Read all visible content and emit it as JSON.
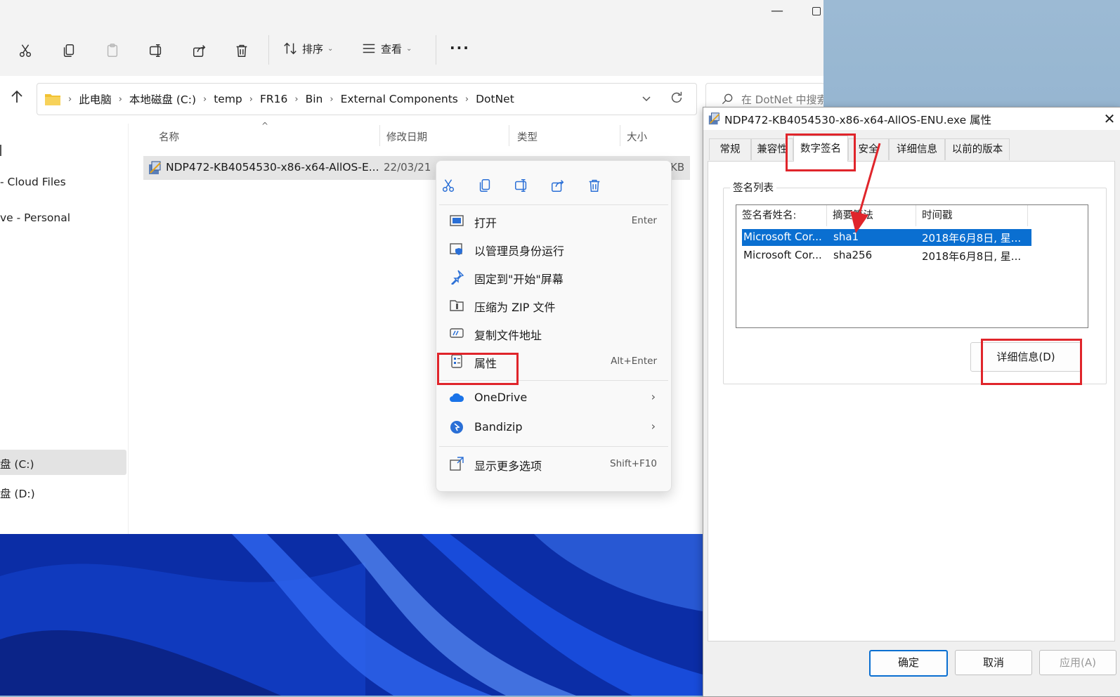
{
  "explorer": {
    "toolbar": {
      "sort_label": "排序",
      "view_label": "查看",
      "more_label": "···"
    },
    "breadcrumbs": [
      "此电脑",
      "本地磁盘 (C:)",
      "temp",
      "FR16",
      "Bin",
      "External Components",
      "DotNet"
    ],
    "search_placeholder": "在 DotNet 中搜索",
    "nav_items": [
      "- Cloud Files",
      "ve - Personal",
      "盘 (C:)",
      "盘 (D:)"
    ],
    "columns": [
      "名称",
      "修改日期",
      "类型",
      "大小"
    ],
    "file": {
      "name": "NDP472-KB4054530-x86-x64-AllOS-E...",
      "date": "22/03/21",
      "size": "KB"
    }
  },
  "context_menu": {
    "items": [
      {
        "label": "打开",
        "shortcut": "Enter"
      },
      {
        "label": "以管理员身份运行",
        "shortcut": ""
      },
      {
        "label": "固定到\"开始\"屏幕",
        "shortcut": ""
      },
      {
        "label": "压缩为 ZIP 文件",
        "shortcut": ""
      },
      {
        "label": "复制文件地址",
        "shortcut": ""
      },
      {
        "label": "属性",
        "shortcut": "Alt+Enter"
      },
      {
        "label": "OneDrive",
        "shortcut": ""
      },
      {
        "label": "Bandizip",
        "shortcut": ""
      },
      {
        "label": "显示更多选项",
        "shortcut": "Shift+F10"
      }
    ]
  },
  "dialog": {
    "title": "NDP472-KB4054530-x86-x64-AllOS-ENU.exe 属性",
    "tabs": [
      "常规",
      "兼容性",
      "数字签名",
      "安全",
      "详细信息",
      "以前的版本"
    ],
    "active_tab": "数字签名",
    "group_label": "签名列表",
    "list_headers": [
      "签名者姓名:",
      "摘要算法",
      "时间戳"
    ],
    "signatures": [
      {
        "signer": "Microsoft Cor...",
        "algo": "sha1",
        "time": "2018年6月8日, 星..."
      },
      {
        "signer": "Microsoft Cor...",
        "algo": "sha256",
        "time": "2018年6月8日, 星..."
      }
    ],
    "details_button": "详细信息(D)",
    "ok": "确定",
    "cancel": "取消",
    "apply": "应用(A)"
  },
  "colors": {
    "highlight_red": "#e0252b",
    "selection_blue": "#0a6fd1",
    "folder_yellow": "#f2c232"
  }
}
